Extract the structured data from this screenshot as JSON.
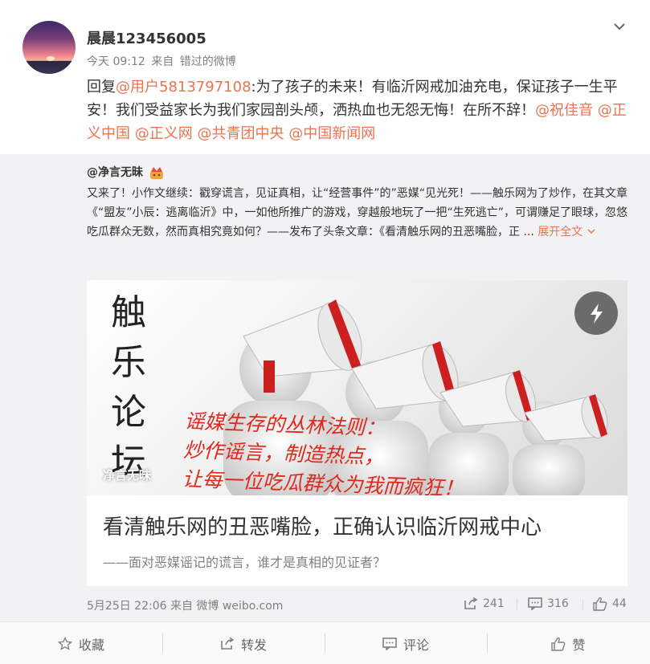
{
  "post": {
    "username": "晨晨123456005",
    "time": "今天 09:12",
    "via_prefix": "来自",
    "via_source": "错过的微博",
    "reply_prefix": "回复",
    "reply_mention": "@用户5813797108",
    "text_main": ":为了孩子的未来！有临沂网戒加油充电，保证孩子一生平安！我们受益家长为我们家园剖头颅，洒热血也无怨无悔！在所不辞！",
    "mentions": [
      "@祝佳音",
      "@正义中国",
      "@正义网",
      "@共青团中央",
      "@中国新闻网"
    ]
  },
  "repost": {
    "author": "@净言无昧",
    "text": "又来了！小作文继续：戳穿谎言，见证真相，让“经营事件”的”恶媒“见光死！——触乐网为了炒作，在其文章《“盟友”小辰：逃离临沂》中，一如他所推广的游戏，穿越般地玩了一把“生死逃亡”，可谓赚足了眼球，忽悠吃瓜群众无数，然而真相究竟如何？——发布了头条文章：《看清触乐网的丑恶嘴脸，正 ...",
    "expand_label": "展开全文",
    "card": {
      "image_title": "触乐论坛",
      "overlay_lines": [
        "谣媒生存的丛林法则：",
        "炒作谣言，制造热点，",
        "让每一位吃瓜群众为我而疯狂！"
      ],
      "watermark": "净言无昧",
      "title": "看清触乐网的丑恶嘴脸，正确认识临沂网戒中心",
      "subtitle": "——面对恶媒谣记的谎言，谁才是真相的见证者？"
    },
    "time": "5月25日 22:06",
    "via_prefix": "来自",
    "via_source": "微博 weibo.com",
    "stats": {
      "reposts": "241",
      "comments": "316",
      "likes": "44"
    }
  },
  "actions": {
    "favorite": "收藏",
    "repost": "转发",
    "comment": "评论",
    "like": "赞"
  },
  "colors": {
    "link": "#eb7350",
    "repost_bg": "#f2f2f5",
    "text": "#333333",
    "muted": "#808080"
  },
  "icons": [
    "chevron-down-icon",
    "crown-emoji-icon",
    "lightning-icon",
    "repost-icon",
    "comment-icon",
    "like-icon",
    "star-icon"
  ]
}
